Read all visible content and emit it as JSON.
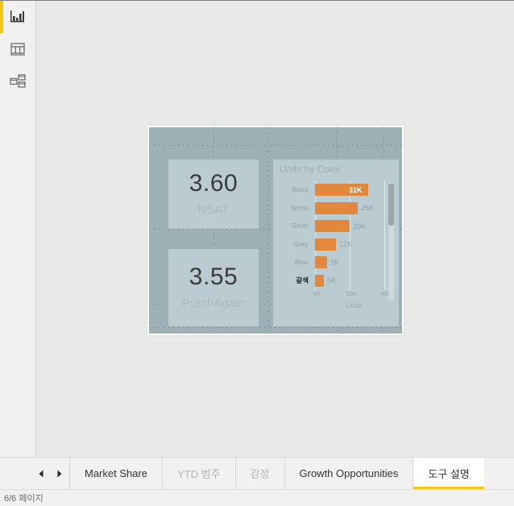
{
  "app": {
    "accent_yellow": "#f2c811",
    "canvas_bg": "#9db0b5",
    "visual_bg": "#bacbd1",
    "bar_color": "#e2883c"
  },
  "sidebar": {
    "items": [
      {
        "name": "report-view",
        "icon": "bar-chart-icon",
        "active": true
      },
      {
        "name": "data-view",
        "icon": "table-icon",
        "active": false
      },
      {
        "name": "model-view",
        "icon": "relationships-icon",
        "active": false
      }
    ]
  },
  "canvas": {
    "kpis": [
      {
        "value": "3.60",
        "label": "NSAT"
      },
      {
        "value": "3.55",
        "label": "PurchAgain"
      }
    ]
  },
  "chart_data": {
    "type": "bar",
    "title": "Units by Color",
    "xlabel": "Units",
    "ylabel": "",
    "orientation": "horizontal",
    "categories": [
      "Black",
      "White",
      "Silver",
      "Grey",
      "Blue",
      "갈색"
    ],
    "values": [
      31000,
      25000,
      20000,
      12000,
      7000,
      5000
    ],
    "data_labels": [
      "31K",
      "25K",
      "20K",
      "12K",
      "7K",
      "5K"
    ],
    "highlighted_category": "갈색",
    "selected_label_index": 0,
    "xlim": [
      0,
      45000
    ],
    "xticks": [
      0,
      20000,
      40000
    ],
    "xtick_labels": [
      "0K",
      "20K",
      "40K"
    ],
    "grid": true,
    "legend": "none",
    "bar_color": "#e2883c",
    "scrollbar": {
      "visible": true,
      "position": "top"
    }
  },
  "tabs": {
    "prev_label": "◀",
    "next_label": "▶",
    "items": [
      {
        "label": "Market Share",
        "state": "normal"
      },
      {
        "label": "YTD 범주",
        "state": "dim"
      },
      {
        "label": "감정",
        "state": "dim"
      },
      {
        "label": "Growth Opportunities",
        "state": "normal"
      },
      {
        "label": "도구 설명",
        "state": "active"
      }
    ]
  },
  "status": {
    "page_text": "6/6 페이지"
  }
}
